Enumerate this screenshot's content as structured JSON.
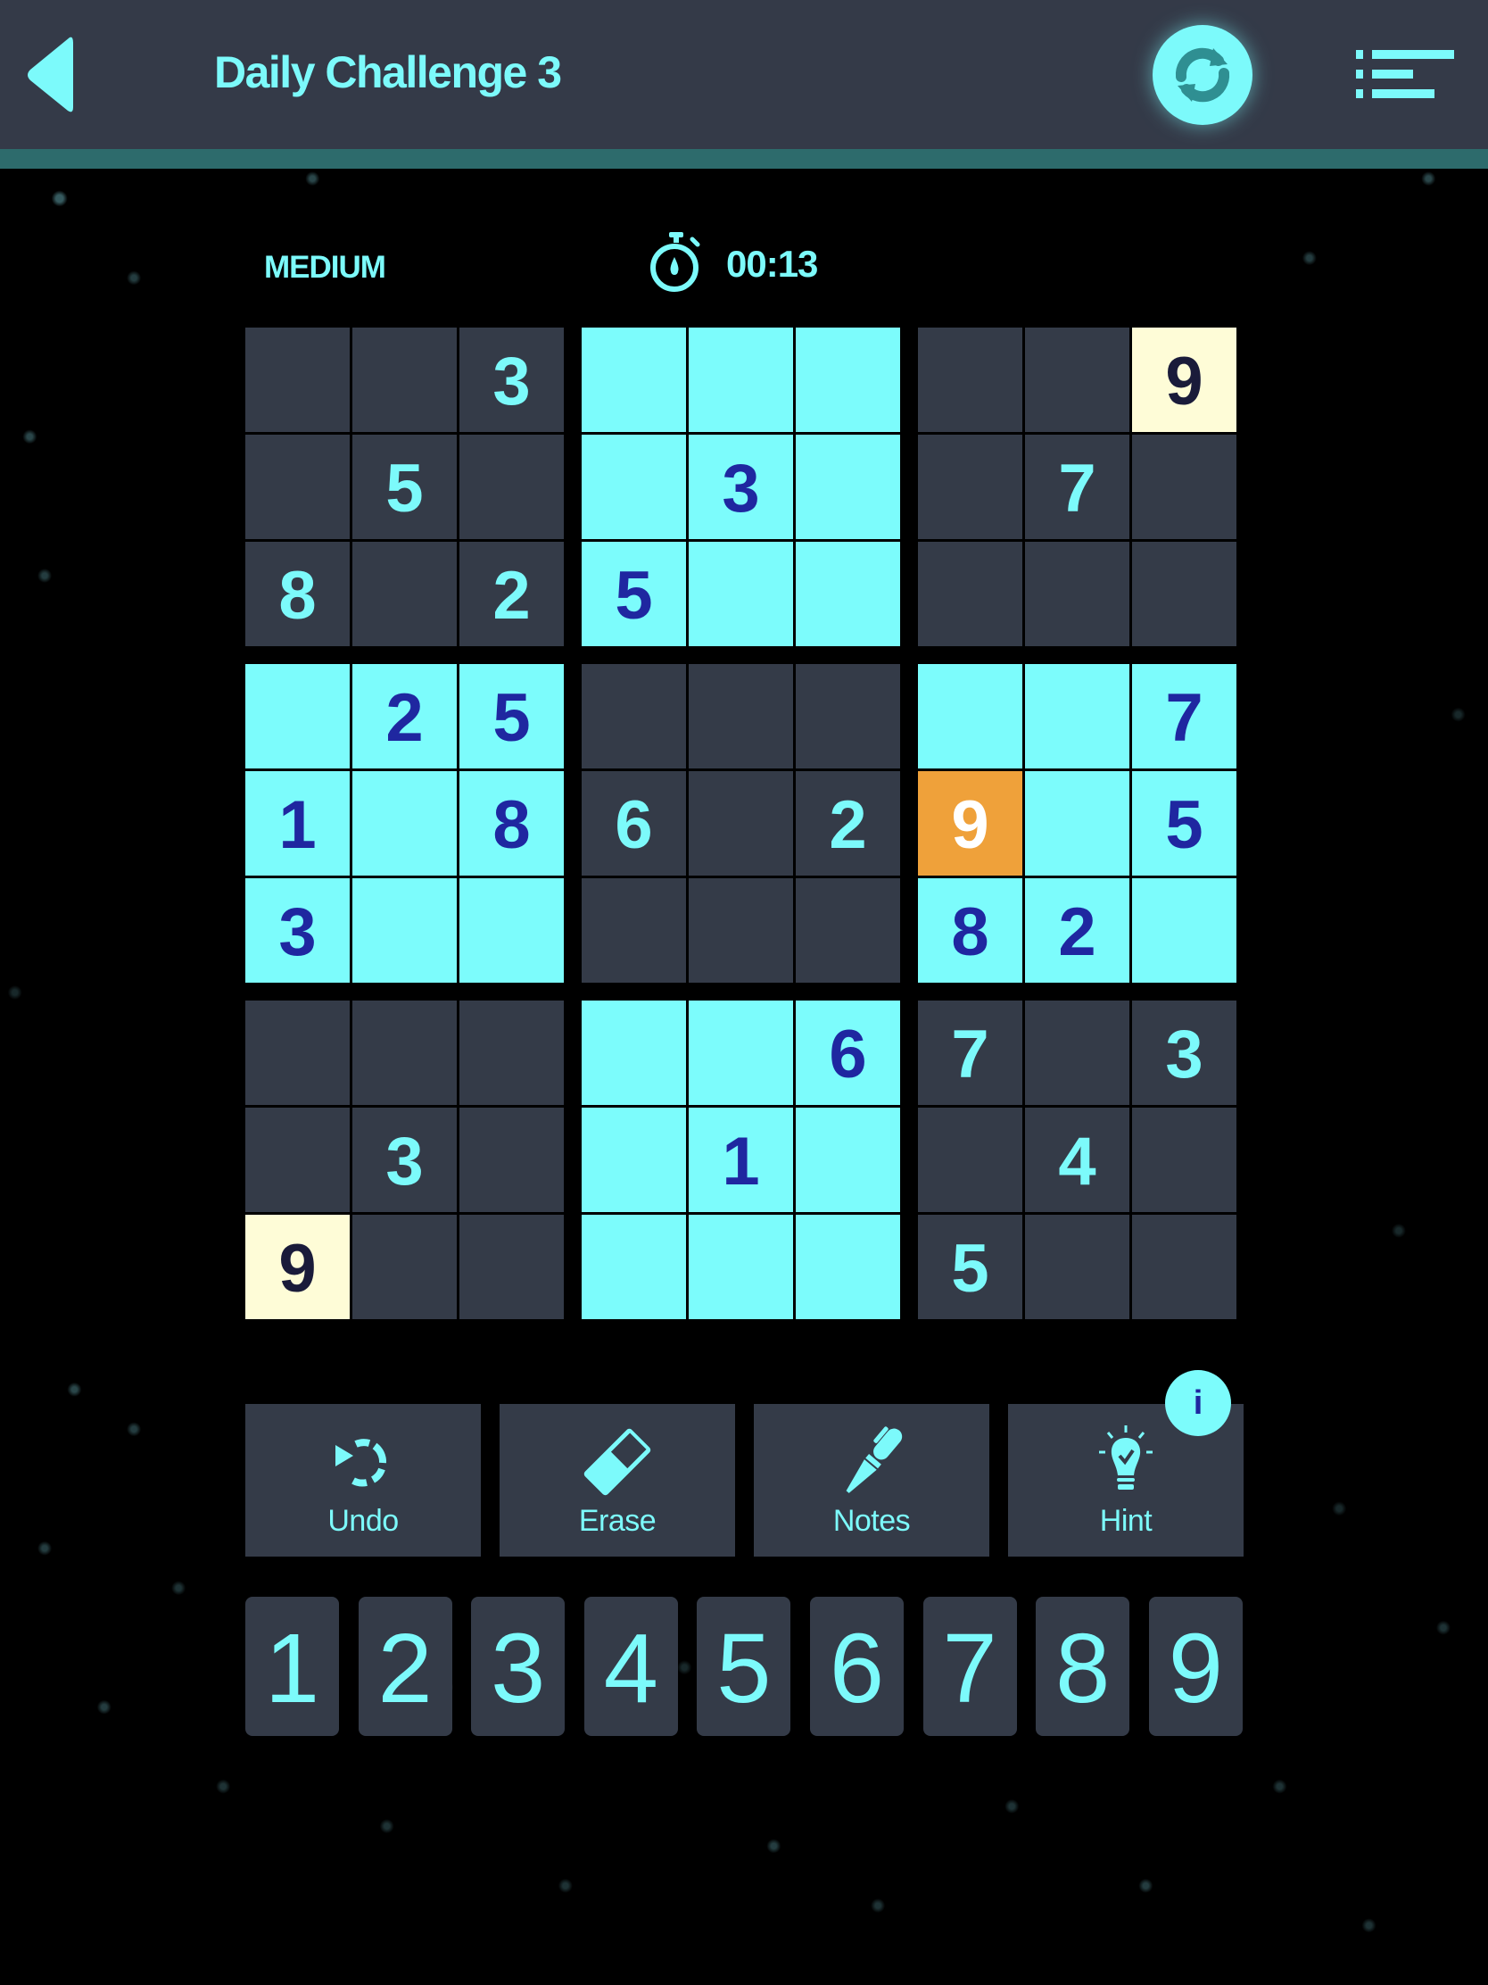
{
  "header": {
    "title": "Daily Challenge 3",
    "back_icon": "back-triangle-icon",
    "refresh_icon": "refresh-icon",
    "menu_icon": "list-menu-icon"
  },
  "status": {
    "difficulty": "MEDIUM",
    "timer": "00:13",
    "timer_icon": "stopwatch-icon"
  },
  "colors": {
    "accent": "#7cfafb",
    "header_bg": "#343a48",
    "cell_dark": "#343b48",
    "cell_highlight": "#7cfcfc",
    "cell_same_number": "#fefcd7",
    "cell_selected": "#efa13a",
    "entered_digit": "#1f27a0"
  },
  "board": {
    "rows": [
      [
        {
          "v": "",
          "s": "dark"
        },
        {
          "v": "",
          "s": "dark"
        },
        {
          "v": "3",
          "s": "dark"
        },
        {
          "v": "",
          "s": "cyan"
        },
        {
          "v": "",
          "s": "cyan"
        },
        {
          "v": "",
          "s": "cyan"
        },
        {
          "v": "",
          "s": "dark"
        },
        {
          "v": "",
          "s": "dark"
        },
        {
          "v": "9",
          "s": "cream"
        }
      ],
      [
        {
          "v": "",
          "s": "dark"
        },
        {
          "v": "5",
          "s": "dark"
        },
        {
          "v": "",
          "s": "dark"
        },
        {
          "v": "",
          "s": "cyan"
        },
        {
          "v": "3",
          "s": "cyan"
        },
        {
          "v": "",
          "s": "cyan"
        },
        {
          "v": "",
          "s": "dark"
        },
        {
          "v": "7",
          "s": "dark"
        },
        {
          "v": "",
          "s": "dark"
        }
      ],
      [
        {
          "v": "8",
          "s": "dark"
        },
        {
          "v": "",
          "s": "dark"
        },
        {
          "v": "2",
          "s": "dark"
        },
        {
          "v": "5",
          "s": "cyan"
        },
        {
          "v": "",
          "s": "cyan"
        },
        {
          "v": "",
          "s": "cyan"
        },
        {
          "v": "",
          "s": "dark"
        },
        {
          "v": "",
          "s": "dark"
        },
        {
          "v": "",
          "s": "dark"
        }
      ],
      [
        {
          "v": "",
          "s": "cyan"
        },
        {
          "v": "2",
          "s": "cyan"
        },
        {
          "v": "5",
          "s": "cyan"
        },
        {
          "v": "",
          "s": "dark"
        },
        {
          "v": "",
          "s": "dark"
        },
        {
          "v": "",
          "s": "dark"
        },
        {
          "v": "",
          "s": "cyan"
        },
        {
          "v": "",
          "s": "cyan"
        },
        {
          "v": "7",
          "s": "cyan"
        }
      ],
      [
        {
          "v": "1",
          "s": "cyan"
        },
        {
          "v": "",
          "s": "cyan"
        },
        {
          "v": "8",
          "s": "cyan"
        },
        {
          "v": "6",
          "s": "dark"
        },
        {
          "v": "",
          "s": "dark"
        },
        {
          "v": "2",
          "s": "dark"
        },
        {
          "v": "9",
          "s": "orange"
        },
        {
          "v": "",
          "s": "cyan"
        },
        {
          "v": "5",
          "s": "cyan"
        }
      ],
      [
        {
          "v": "3",
          "s": "cyan"
        },
        {
          "v": "",
          "s": "cyan"
        },
        {
          "v": "",
          "s": "cyan"
        },
        {
          "v": "",
          "s": "dark"
        },
        {
          "v": "",
          "s": "dark"
        },
        {
          "v": "",
          "s": "dark"
        },
        {
          "v": "8",
          "s": "cyan"
        },
        {
          "v": "2",
          "s": "cyan"
        },
        {
          "v": "",
          "s": "cyan"
        }
      ],
      [
        {
          "v": "",
          "s": "dark"
        },
        {
          "v": "",
          "s": "dark"
        },
        {
          "v": "",
          "s": "dark"
        },
        {
          "v": "",
          "s": "cyan"
        },
        {
          "v": "",
          "s": "cyan"
        },
        {
          "v": "6",
          "s": "cyan"
        },
        {
          "v": "7",
          "s": "dark"
        },
        {
          "v": "",
          "s": "dark"
        },
        {
          "v": "3",
          "s": "dark"
        }
      ],
      [
        {
          "v": "",
          "s": "dark"
        },
        {
          "v": "3",
          "s": "dark"
        },
        {
          "v": "",
          "s": "dark"
        },
        {
          "v": "",
          "s": "cyan"
        },
        {
          "v": "1",
          "s": "cyan"
        },
        {
          "v": "",
          "s": "cyan"
        },
        {
          "v": "",
          "s": "dark"
        },
        {
          "v": "4",
          "s": "dark"
        },
        {
          "v": "",
          "s": "dark"
        }
      ],
      [
        {
          "v": "9",
          "s": "cream"
        },
        {
          "v": "",
          "s": "dark"
        },
        {
          "v": "",
          "s": "dark"
        },
        {
          "v": "",
          "s": "cyan"
        },
        {
          "v": "",
          "s": "cyan"
        },
        {
          "v": "",
          "s": "cyan"
        },
        {
          "v": "5",
          "s": "dark"
        },
        {
          "v": "",
          "s": "dark"
        },
        {
          "v": "",
          "s": "dark"
        }
      ]
    ],
    "selected": {
      "row": 5,
      "col": 7,
      "value": "9"
    }
  },
  "tools": [
    {
      "label": "Undo",
      "icon": "undo-icon"
    },
    {
      "label": "Erase",
      "icon": "eraser-icon"
    },
    {
      "label": "Notes",
      "icon": "pen-icon"
    },
    {
      "label": "Hint",
      "icon": "lightbulb-icon"
    }
  ],
  "hint_badge": "i",
  "numpad": [
    "1",
    "2",
    "3",
    "4",
    "5",
    "6",
    "7",
    "8",
    "9"
  ]
}
